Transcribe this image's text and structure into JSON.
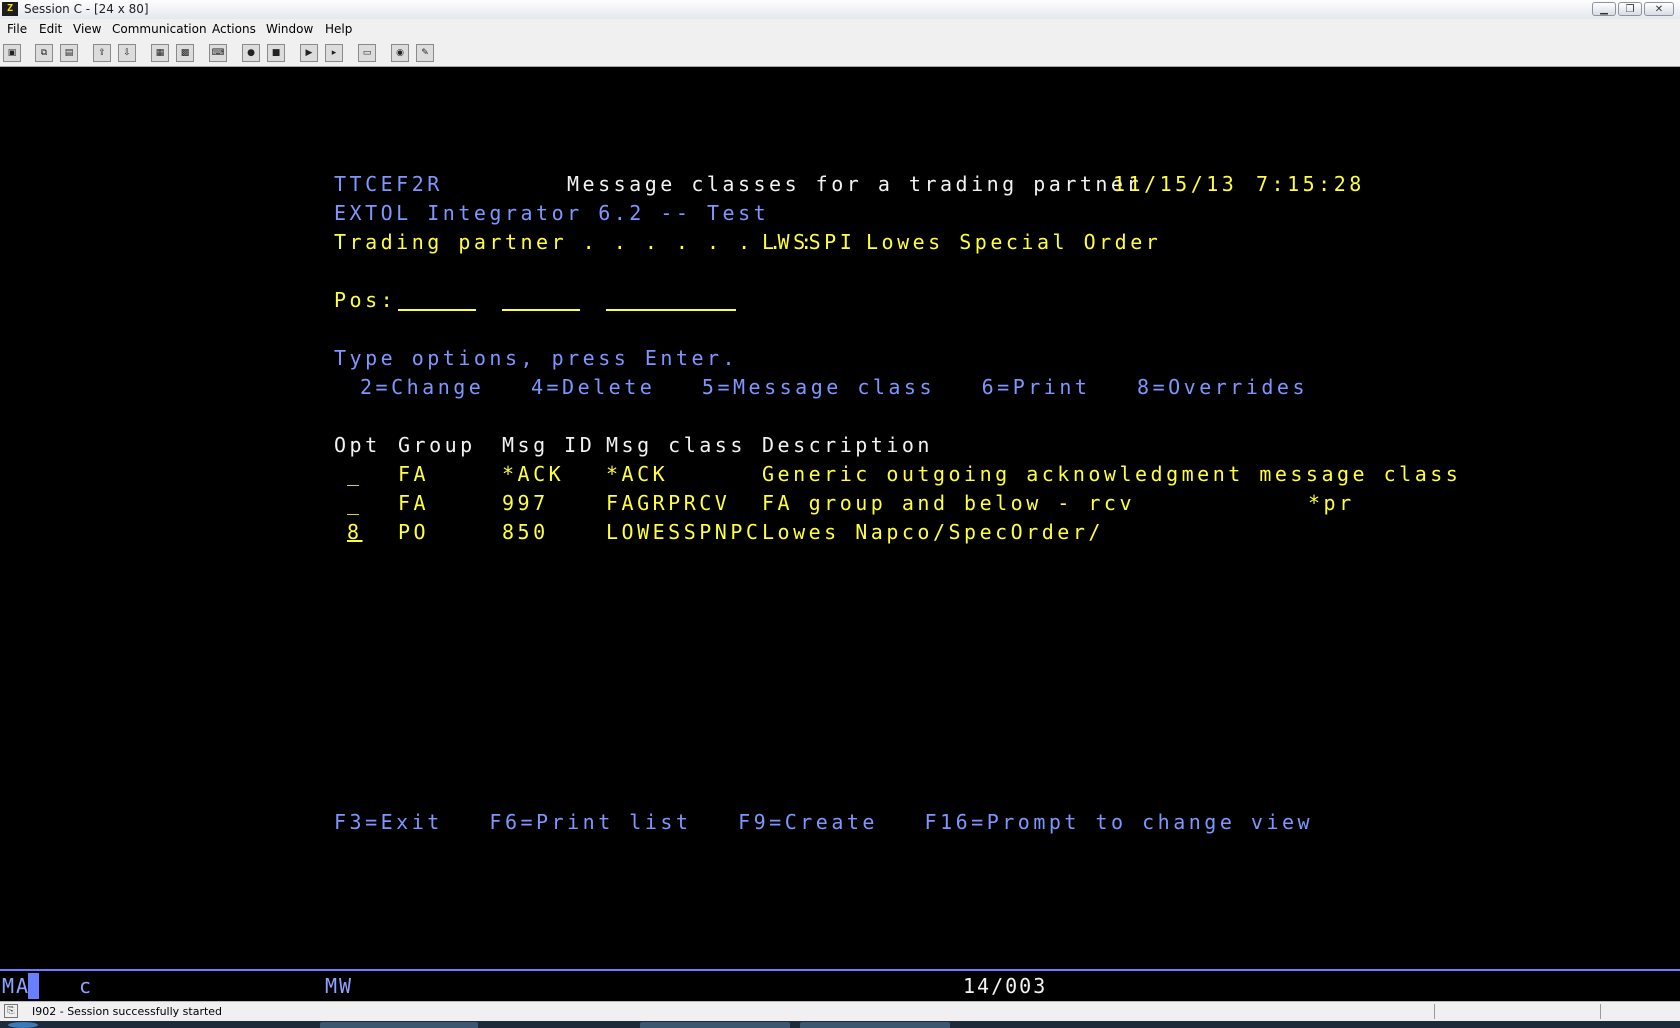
{
  "window": {
    "title": "Session C - [24 x 80]"
  },
  "menu": {
    "items": [
      {
        "label": "File"
      },
      {
        "label": "Edit"
      },
      {
        "label": "View"
      },
      {
        "label": "Communication"
      },
      {
        "label": "Actions"
      },
      {
        "label": "Window"
      },
      {
        "label": "Help"
      }
    ]
  },
  "toolbar": {
    "icons": [
      "print-screen-icon",
      "copy-icon",
      "paste-icon",
      "send-file-icon",
      "receive-file-icon",
      "display-icon",
      "color-map-icon",
      "keyboard-map-icon",
      "macro-record-icon",
      "macro-stop-icon",
      "macro-play-icon",
      "macro-icon",
      "clipboard-icon",
      "globe-icon",
      "help-tag-icon"
    ]
  },
  "screen": {
    "program": "TTCEF2R",
    "title": "Message classes for a trading partner",
    "date": "11/15/13",
    "time": "7:15:28",
    "subtitle": "EXTOL Integrator 6.2 -- Test",
    "partner_label": "Trading partner . . . . . . . :",
    "partner_code": "LWSSPI",
    "partner_name": "Lowes Special Order",
    "pos_label": "Pos:",
    "instructions": "Type options, press Enter.",
    "options": "2=Change   4=Delete   5=Message class   6=Print   8=Overrides",
    "columns": {
      "opt": "Opt",
      "group": "Group",
      "msgid": "Msg ID",
      "msgclass": "Msg class",
      "desc": "Description"
    },
    "rows": [
      {
        "opt": "_",
        "group": "FA",
        "msgid": "*ACK",
        "msgclass": "*ACK",
        "desc": "Generic outgoing acknowledgment message class",
        "flag": ""
      },
      {
        "opt": "_",
        "group": "FA",
        "msgid": "997",
        "msgclass": "FAGRPRCV",
        "desc": "FA group and below - rcv",
        "flag": "*pr"
      },
      {
        "opt": "8",
        "group": "PO",
        "msgid": "850",
        "msgclass": "LOWESSPNPC",
        "desc": "Lowes Napco/SpecOrder/",
        "flag": ""
      }
    ],
    "fkeys": "F3=Exit   F6=Print list   F9=Create   F16=Prompt to change view"
  },
  "oia": {
    "mode": "MA",
    "session": "c",
    "mw": "MW",
    "cursor": "14/003"
  },
  "status": {
    "message": "I902 - Session successfully started"
  },
  "colors": {
    "yellow": "#ffff3a",
    "blue": "#7e96ff",
    "white": "#f2f2f2",
    "background": "#000000"
  }
}
